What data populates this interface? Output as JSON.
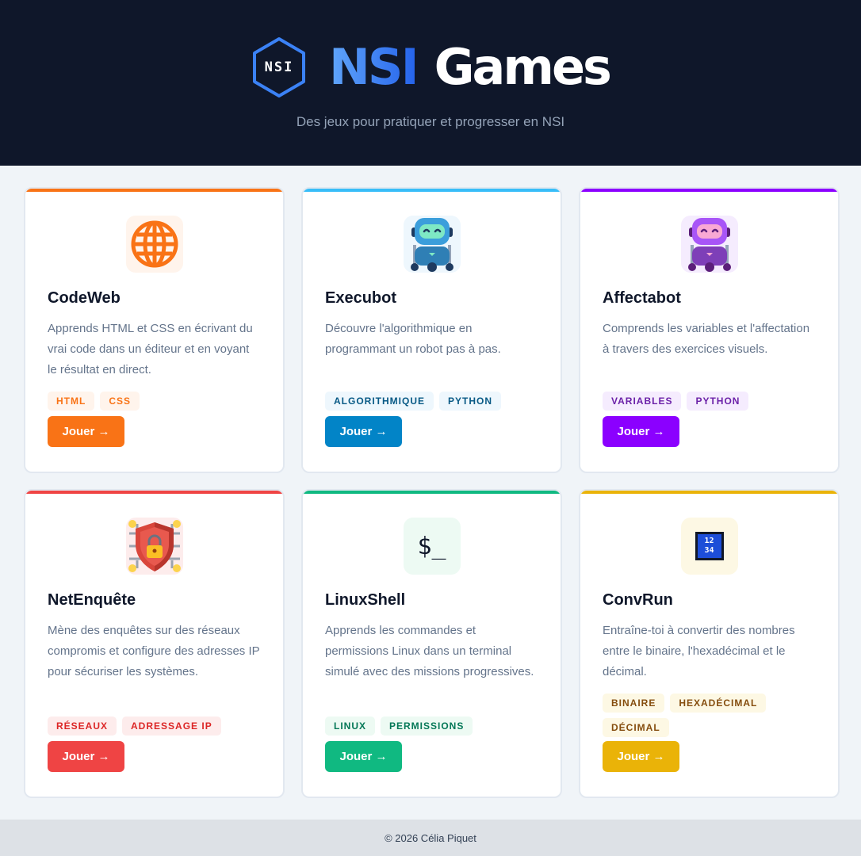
{
  "header": {
    "logo_text": "NSI",
    "title_accent": "NSI",
    "title_main": "Games",
    "subtitle": "Des jeux pour pratiquer et progresser en NSI"
  },
  "games": [
    {
      "title": "CodeWeb",
      "description": "Apprends HTML et CSS en écrivant du vrai code dans un éditeur et en voyant le résultat en direct.",
      "tags": [
        "HTML",
        "CSS"
      ],
      "button": "Jouer →",
      "icon": "globe-icon",
      "accent": "#f97316"
    },
    {
      "title": "Execubot",
      "description": "Découvre l'algorithmique en programmant un robot pas à pas.",
      "tags": [
        "ALGORITHMIQUE",
        "PYTHON"
      ],
      "button": "Jouer →",
      "icon": "blue-robot-icon",
      "accent": "#0284c7"
    },
    {
      "title": "Affectabot",
      "description": "Comprends les variables et l'affectation à travers des exercices visuels.",
      "tags": [
        "VARIABLES",
        "PYTHON"
      ],
      "button": "Jouer →",
      "icon": "purple-robot-icon",
      "accent": "#8b00ff"
    },
    {
      "title": "NetEnquête",
      "description": "Mène des enquêtes sur des réseaux compromis et configure des adresses IP pour sécuriser les systèmes.",
      "tags": [
        "RÉSEAUX",
        "ADRESSAGE IP"
      ],
      "button": "Jouer →",
      "icon": "shield-lock-icon",
      "accent": "#ef4444"
    },
    {
      "title": "LinuxShell",
      "description": "Apprends les commandes et permissions Linux dans un terminal simulé avec des missions progressives.",
      "tags": [
        "LINUX",
        "PERMISSIONS"
      ],
      "button": "Jouer →",
      "icon": "terminal-prompt-icon",
      "icon_text": "$_",
      "accent": "#10b981"
    },
    {
      "title": "ConvRun",
      "description": "Entraîne-toi à convertir des nombres entre le binaire, l'hexadécimal et le décimal.",
      "tags": [
        "BINAIRE",
        "HEXADÉCIMAL",
        "DÉCIMAL"
      ],
      "button": "Jouer →",
      "icon": "numbers-keycap-icon",
      "icon_text_top": "12",
      "icon_text_bottom": "34",
      "accent": "#eab308"
    }
  ],
  "footer": {
    "text": "© 2026 Célia Piquet"
  }
}
